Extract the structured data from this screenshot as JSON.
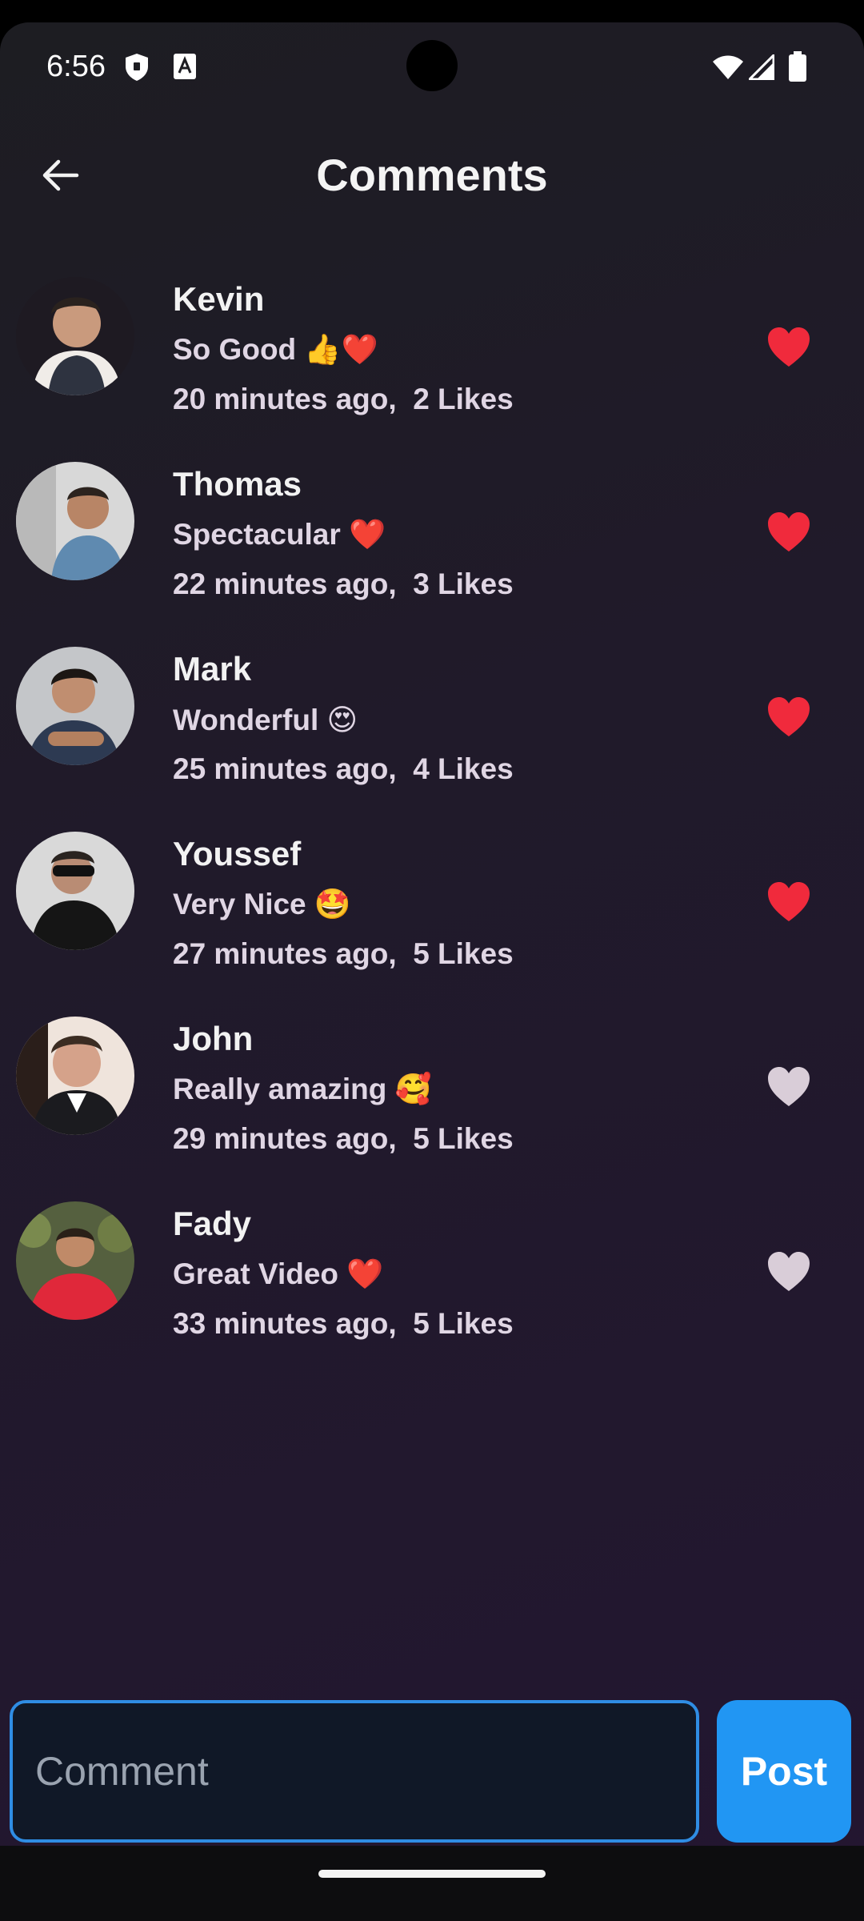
{
  "status_bar": {
    "time": "6:56"
  },
  "header": {
    "title": "Comments"
  },
  "comments": [
    {
      "name": "Kevin",
      "text": "So Good 👍❤️",
      "meta": "20 minutes ago,  2 Likes",
      "liked": true
    },
    {
      "name": "Thomas",
      "text": "Spectacular ❤️",
      "meta": "22 minutes ago,  3 Likes",
      "liked": true
    },
    {
      "name": "Mark",
      "text": "Wonderful 😍",
      "meta": "25 minutes ago,  4 Likes",
      "liked": true
    },
    {
      "name": "Youssef",
      "text": "Very Nice 🤩",
      "meta": "27 minutes ago,  5 Likes",
      "liked": true
    },
    {
      "name": "John",
      "text": "Really amazing 🥰",
      "meta": "29 minutes ago,  5 Likes",
      "liked": false
    },
    {
      "name": "Fady",
      "text": "Great Video ❤️",
      "meta": "33 minutes ago,  5 Likes",
      "liked": false
    }
  ],
  "composer": {
    "placeholder": "Comment",
    "post_label": "Post"
  },
  "colors": {
    "accent": "#2196f3",
    "liked_heart": "#f02a3c",
    "unliked_heart": "#d9cdd8"
  }
}
